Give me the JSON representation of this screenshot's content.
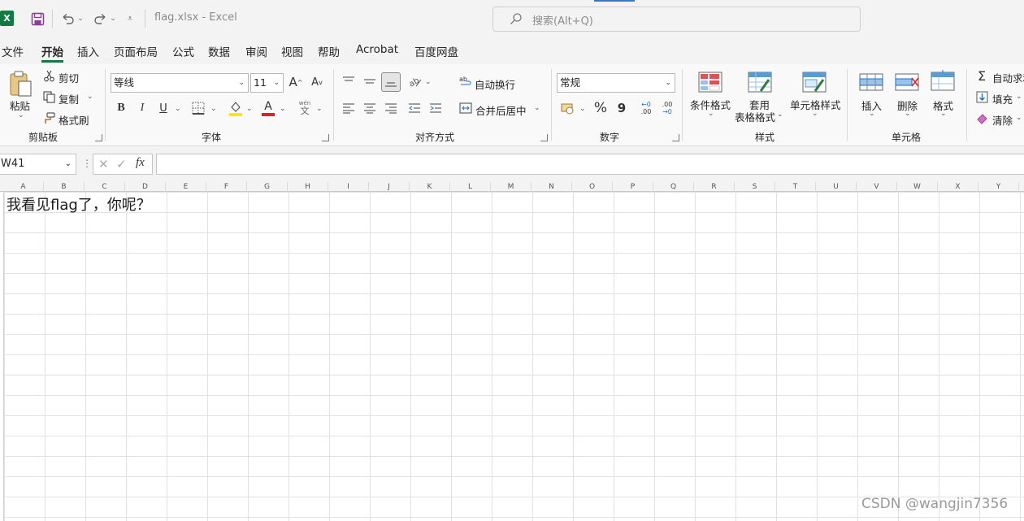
{
  "titlebar": {
    "excel_logo": "X",
    "doc_title": "flag.xlsx  -  Excel",
    "search_placeholder": "搜索(Alt+Q)"
  },
  "tabs": [
    "文件",
    "开始",
    "插入",
    "页面布局",
    "公式",
    "数据",
    "审阅",
    "视图",
    "帮助",
    "Acrobat",
    "百度网盘"
  ],
  "active_tab": "开始",
  "ribbon": {
    "clipboard": {
      "paste": "粘贴",
      "cut": "剪切",
      "copy": "复制",
      "format_painter": "格式刷",
      "group_label": "剪贴板"
    },
    "font": {
      "font_name": "等线",
      "font_size": "11",
      "grow": "A",
      "shrink": "A",
      "bold": "B",
      "italic": "I",
      "underline": "U",
      "font_color_glyph": "A",
      "phonetic_top": "wén",
      "phonetic_bottom": "文",
      "group_label": "字体"
    },
    "alignment": {
      "wrap_text": "自动换行",
      "merge_center": "合并后居中",
      "group_label": "对齐方式"
    },
    "number": {
      "format": "常规",
      "percent": "%",
      "comma": "9",
      "inc_decimal_top": "←0",
      "inc_decimal_bottom": ".00",
      "dec_decimal_top": ".00",
      "dec_decimal_bottom": "→0",
      "group_label": "数字"
    },
    "styles": {
      "conditional": "条件格式",
      "table_format_1": "套用",
      "table_format_2": "表格格式",
      "cell_styles": "单元格样式",
      "group_label": "样式"
    },
    "cells": {
      "insert": "插入",
      "delete": "删除",
      "format": "格式",
      "group_label": "单元格"
    },
    "editing": {
      "autosum": "自动求和",
      "fill": "填充",
      "clear": "清除"
    }
  },
  "formula_bar": {
    "name_box": "W41",
    "fx": "fx",
    "formula": ""
  },
  "columns": [
    "A",
    "B",
    "C",
    "D",
    "E",
    "F",
    "G",
    "H",
    "I",
    "J",
    "K",
    "L",
    "M",
    "N",
    "O",
    "P",
    "Q",
    "R",
    "S",
    "T",
    "U",
    "V",
    "W",
    "X",
    "Y"
  ],
  "cell_a1": "我看见flag了，你呢？",
  "watermark": "CSDN @wangjin7356",
  "colors": {
    "excel_green": "#107c41",
    "accent_blue": "#3a78c6",
    "font_red": "#e02020",
    "highlight_yellow": "#ffe800"
  }
}
